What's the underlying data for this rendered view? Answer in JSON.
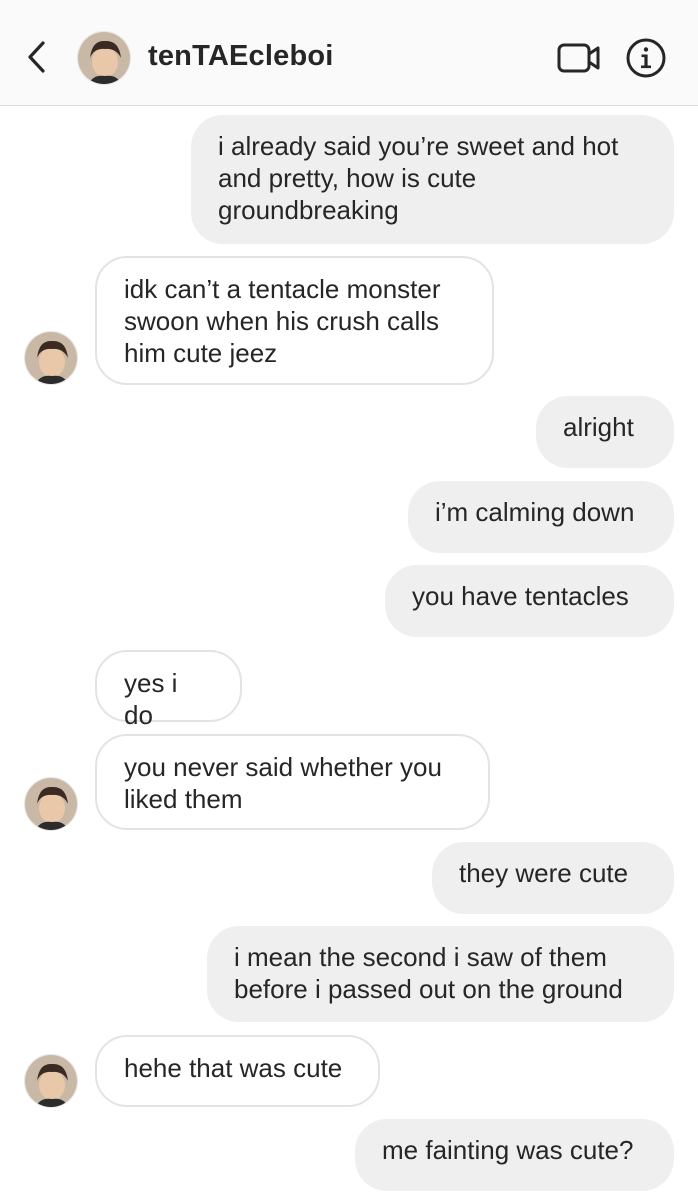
{
  "header": {
    "title": "tenTAEcleboi",
    "back_icon": "chevron-left-icon",
    "video_icon": "video-camera-icon",
    "info_icon": "info-icon"
  },
  "colors": {
    "outgoing_bubble": "#efefef",
    "incoming_border": "#e3e3e3",
    "text": "#262626",
    "header_bg": "#fafafa"
  },
  "messages": [
    {
      "side": "out",
      "text": "i already said you’re sweet and hot\nand pretty, how is cute\ngroundbreaking"
    },
    {
      "side": "in",
      "text": "idk can’t a tentacle monster\nswoon when his crush calls\nhim cute jeez"
    },
    {
      "side": "out",
      "text": "alright"
    },
    {
      "side": "out",
      "text": "i’m calming down"
    },
    {
      "side": "out",
      "text": "you have tentacles"
    },
    {
      "side": "in",
      "text": "yes i do"
    },
    {
      "side": "in",
      "text": "you never said whether you\nliked them"
    },
    {
      "side": "out",
      "text": "they were cute"
    },
    {
      "side": "out",
      "text": "i mean the second i saw of them\nbefore i passed out on the ground"
    },
    {
      "side": "in",
      "text": "hehe that was cute"
    },
    {
      "side": "out",
      "text": "me fainting was cute?"
    }
  ]
}
